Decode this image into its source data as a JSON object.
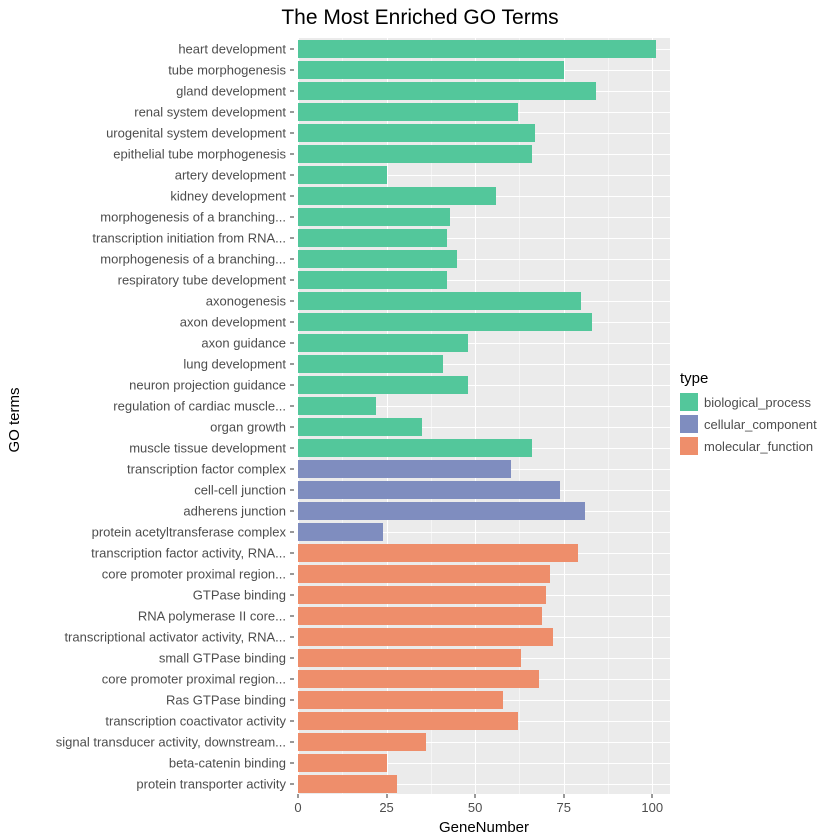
{
  "chart_data": {
    "type": "bar",
    "title": "The Most Enriched GO Terms",
    "xlabel": "GeneNumber",
    "ylabel": "GO terms",
    "xlim": [
      0,
      105
    ],
    "xticks": [
      0,
      25,
      50,
      75,
      100
    ],
    "legend_title": "type",
    "series_colors": {
      "biological_process": "#53c79b",
      "cellular_component": "#7f8dbf",
      "molecular_function": "#ee8e6b"
    },
    "categories": [
      {
        "label": "heart development",
        "value": 101,
        "type": "biological_process"
      },
      {
        "label": "tube morphogenesis",
        "value": 75,
        "type": "biological_process"
      },
      {
        "label": "gland development",
        "value": 84,
        "type": "biological_process"
      },
      {
        "label": "renal system development",
        "value": 62,
        "type": "biological_process"
      },
      {
        "label": "urogenital system development",
        "value": 67,
        "type": "biological_process"
      },
      {
        "label": "epithelial tube morphogenesis",
        "value": 66,
        "type": "biological_process"
      },
      {
        "label": "artery development",
        "value": 25,
        "type": "biological_process"
      },
      {
        "label": "kidney development",
        "value": 56,
        "type": "biological_process"
      },
      {
        "label": "morphogenesis of a branching...",
        "value": 43,
        "type": "biological_process"
      },
      {
        "label": "transcription initiation from RNA...",
        "value": 42,
        "type": "biological_process"
      },
      {
        "label": "morphogenesis of a branching...",
        "value": 45,
        "type": "biological_process"
      },
      {
        "label": "respiratory tube development",
        "value": 42,
        "type": "biological_process"
      },
      {
        "label": "axonogenesis",
        "value": 80,
        "type": "biological_process"
      },
      {
        "label": "axon development",
        "value": 83,
        "type": "biological_process"
      },
      {
        "label": "axon guidance",
        "value": 48,
        "type": "biological_process"
      },
      {
        "label": "lung development",
        "value": 41,
        "type": "biological_process"
      },
      {
        "label": "neuron projection guidance",
        "value": 48,
        "type": "biological_process"
      },
      {
        "label": "regulation of cardiac muscle...",
        "value": 22,
        "type": "biological_process"
      },
      {
        "label": "organ growth",
        "value": 35,
        "type": "biological_process"
      },
      {
        "label": "muscle tissue development",
        "value": 66,
        "type": "biological_process"
      },
      {
        "label": "transcription factor complex",
        "value": 60,
        "type": "cellular_component"
      },
      {
        "label": "cell-cell junction",
        "value": 74,
        "type": "cellular_component"
      },
      {
        "label": "adherens junction",
        "value": 81,
        "type": "cellular_component"
      },
      {
        "label": "protein acetyltransferase complex",
        "value": 24,
        "type": "cellular_component"
      },
      {
        "label": "transcription factor activity, RNA...",
        "value": 79,
        "type": "molecular_function"
      },
      {
        "label": "core promoter proximal region...",
        "value": 71,
        "type": "molecular_function"
      },
      {
        "label": "GTPase binding",
        "value": 70,
        "type": "molecular_function"
      },
      {
        "label": "RNA polymerase II core...",
        "value": 69,
        "type": "molecular_function"
      },
      {
        "label": "transcriptional activator activity, RNA...",
        "value": 72,
        "type": "molecular_function"
      },
      {
        "label": "small GTPase binding",
        "value": 63,
        "type": "molecular_function"
      },
      {
        "label": "core promoter proximal region...",
        "value": 68,
        "type": "molecular_function"
      },
      {
        "label": "Ras GTPase binding",
        "value": 58,
        "type": "molecular_function"
      },
      {
        "label": "transcription coactivator activity",
        "value": 62,
        "type": "molecular_function"
      },
      {
        "label": "signal transducer activity, downstream...",
        "value": 36,
        "type": "molecular_function"
      },
      {
        "label": "beta-catenin binding",
        "value": 25,
        "type": "molecular_function"
      },
      {
        "label": "protein transporter activity",
        "value": 28,
        "type": "molecular_function"
      }
    ]
  }
}
